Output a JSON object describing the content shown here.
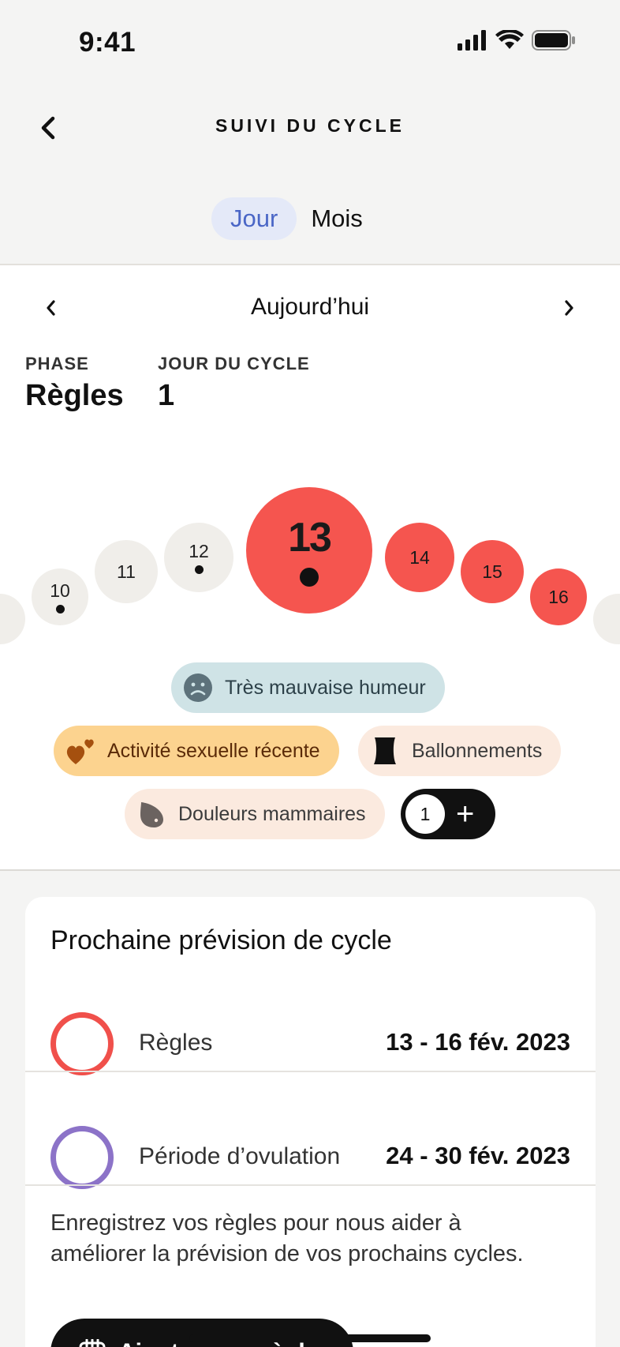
{
  "status_bar": {
    "time": "9:41"
  },
  "header": {
    "title": "SUIVI DU CYCLE",
    "tabs": [
      {
        "label": "Jour",
        "active": true
      },
      {
        "label": "Mois",
        "active": false
      }
    ]
  },
  "day_view": {
    "nav_label": "Aujourd’hui",
    "phase_label": "PHASE",
    "phase_value": "Règles",
    "cycle_day_label": "JOUR DU CYCLE",
    "cycle_day_value": "1",
    "days": [
      {
        "number": "10",
        "type": "past",
        "logged": true
      },
      {
        "number": "11",
        "type": "past",
        "logged": false
      },
      {
        "number": "12",
        "type": "past",
        "logged": true
      },
      {
        "number": "13",
        "type": "period",
        "selected": true,
        "logged": true
      },
      {
        "number": "14",
        "type": "period",
        "logged": false
      },
      {
        "number": "15",
        "type": "period",
        "logged": false
      },
      {
        "number": "16",
        "type": "period",
        "logged": false
      }
    ],
    "symptoms": [
      {
        "label": "Très mauvaise humeur",
        "icon": "sad-face-icon"
      },
      {
        "label": "Activité sexuelle récente",
        "icon": "hearts-icon"
      },
      {
        "label": "Ballonnements",
        "icon": "bloating-icon"
      },
      {
        "label": "Douleurs mammaires",
        "icon": "breast-icon"
      }
    ],
    "extra_count": "1",
    "add_symbol": "+"
  },
  "prediction": {
    "title": "Prochaine prévision de cycle",
    "rows": [
      {
        "name": "Règles",
        "dates": "13 - 16 fév. 2023",
        "color": "#f0504b"
      },
      {
        "name": "Période d’ovulation",
        "dates": "24 - 30 fév. 2023",
        "color": "#8c73c8"
      }
    ],
    "note": "Enregistrez vos règles pour nous aider à améliorer la prévision de vos prochains cycles.",
    "button_label": "Ajouter mes règles"
  },
  "colors": {
    "period": "#f5554f",
    "past_day": "#f0eeea",
    "accent_blue": "#4a66c6",
    "mood_chip": "#cfe3e6",
    "sex_chip": "#fcd38f",
    "peach_chip": "#fbeadf"
  }
}
